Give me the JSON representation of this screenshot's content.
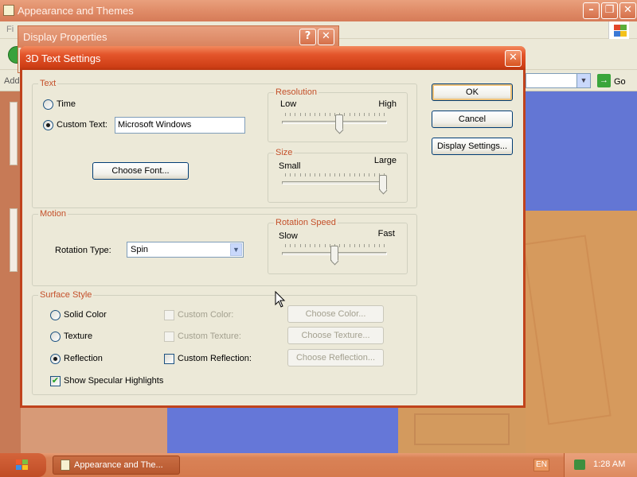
{
  "background": {
    "window_title": "Appearance and Themes",
    "menu_first": "Fi",
    "address_label": "Add",
    "go_label": "Go",
    "dp_title": "Display Properties"
  },
  "dialog": {
    "title": "3D Text Settings",
    "text_group": {
      "legend": "Text",
      "time_label": "Time",
      "custom_text_label": "Custom Text:",
      "custom_text_value": "Microsoft Windows",
      "choose_font": "Choose Font...",
      "selected": "Custom Text"
    },
    "resolution": {
      "legend": "Resolution",
      "min_label": "Low",
      "max_label": "High",
      "value": 0.55
    },
    "size": {
      "legend": "Size",
      "min_label": "Small",
      "max_label": "Large",
      "value": 1.0
    },
    "motion_group": {
      "legend": "Motion",
      "rotation_type_label": "Rotation Type:",
      "rotation_type_value": "Spin"
    },
    "rotation_speed": {
      "legend": "Rotation Speed",
      "min_label": "Slow",
      "max_label": "Fast",
      "value": 0.5
    },
    "surface_group": {
      "legend": "Surface Style",
      "solid_color": "Solid Color",
      "texture": "Texture",
      "reflection": "Reflection",
      "selected": "Reflection",
      "custom_color": "Custom Color:",
      "custom_texture": "Custom Texture:",
      "custom_reflection": "Custom Reflection:",
      "choose_color": "Choose Color...",
      "choose_texture": "Choose Texture...",
      "choose_reflection": "Choose Reflection...",
      "specular": "Show Specular Highlights",
      "specular_checked": true
    },
    "buttons": {
      "ok": "OK",
      "cancel": "Cancel",
      "display_settings": "Display Settings..."
    }
  },
  "taskbar": {
    "task_label": "Appearance and The...",
    "language": "EN",
    "clock": "1:28 AM"
  },
  "colors": {
    "dialog_title_bar": "#d84a1f",
    "group_legend": "#c4502a",
    "taskbar": "#d57a4e"
  }
}
